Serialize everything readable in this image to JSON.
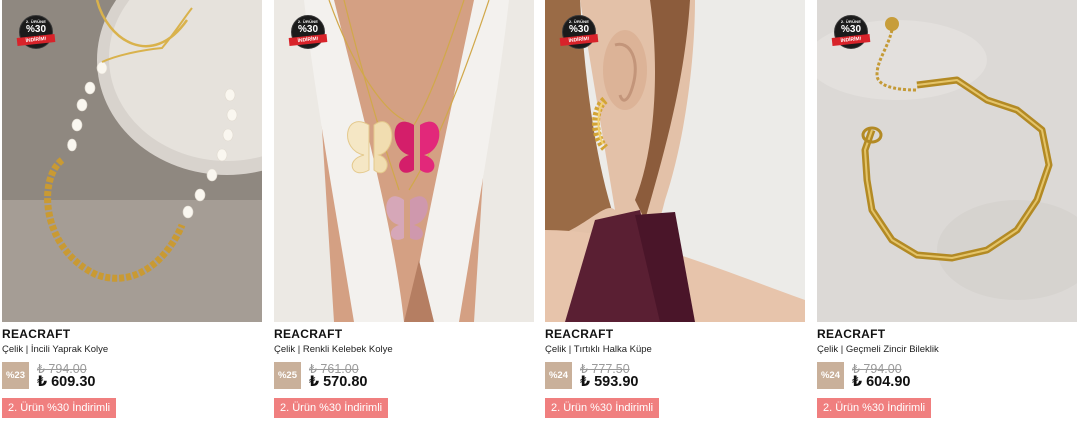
{
  "campaign_badge": {
    "top_text": "2. ÜRÜNE",
    "percent": "%30",
    "ribbon": "İNDİRİM!"
  },
  "products": [
    {
      "brand": "REACRAFT",
      "name": "Çelik | İncili Yaprak Kolye",
      "discount": "%23",
      "old_price": "₺ 794.00",
      "price": "₺ 609.30",
      "promo": "2. Ürün %30 İndirimli",
      "image": "pearl-leaf-necklace-on-marble"
    },
    {
      "brand": "REACRAFT",
      "name": "Çelik | Renkli Kelebek Kolye",
      "discount": "%25",
      "old_price": "₺ 761.00",
      "price": "₺ 570.80",
      "promo": "2. Ürün %30 İndirimli",
      "image": "butterfly-necklace-on-model"
    },
    {
      "brand": "REACRAFT",
      "name": "Çelik | Tırtıklı Halka Küpe",
      "discount": "%24",
      "old_price": "₺ 777.50",
      "price": "₺ 593.90",
      "promo": "2. Ürün %30 İndirimli",
      "image": "ridged-hoop-earring-on-model"
    },
    {
      "brand": "REACRAFT",
      "name": "Çelik | Geçmeli Zincir Bileklik",
      "discount": "%24",
      "old_price": "₺ 794.00",
      "price": "₺ 604.90",
      "promo": "2. Ürün %30 İndirimli",
      "image": "chain-bracelet-on-marble"
    }
  ]
}
